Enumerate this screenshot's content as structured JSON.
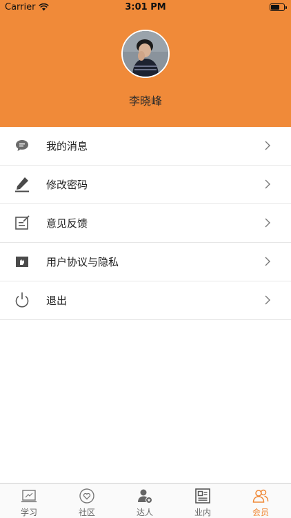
{
  "status_bar": {
    "carrier": "Carrier",
    "time": "3:01 PM"
  },
  "profile": {
    "name": "李晓峰"
  },
  "menu": [
    {
      "label": "我的消息",
      "icon": "message-icon"
    },
    {
      "label": "修改密码",
      "icon": "edit-pen-icon"
    },
    {
      "label": "意见反馈",
      "icon": "feedback-icon"
    },
    {
      "label": "用户协议与隐私",
      "icon": "agreement-icon"
    },
    {
      "label": "退出",
      "icon": "power-icon"
    }
  ],
  "tabs": [
    {
      "label": "学习",
      "icon": "study-icon",
      "active": false
    },
    {
      "label": "社区",
      "icon": "community-icon",
      "active": false
    },
    {
      "label": "达人",
      "icon": "expert-icon",
      "active": false
    },
    {
      "label": "业内",
      "icon": "industry-icon",
      "active": false
    },
    {
      "label": "会员",
      "icon": "member-icon",
      "active": true
    }
  ],
  "colors": {
    "accent": "#f08a39",
    "icon_gray": "#555555"
  }
}
